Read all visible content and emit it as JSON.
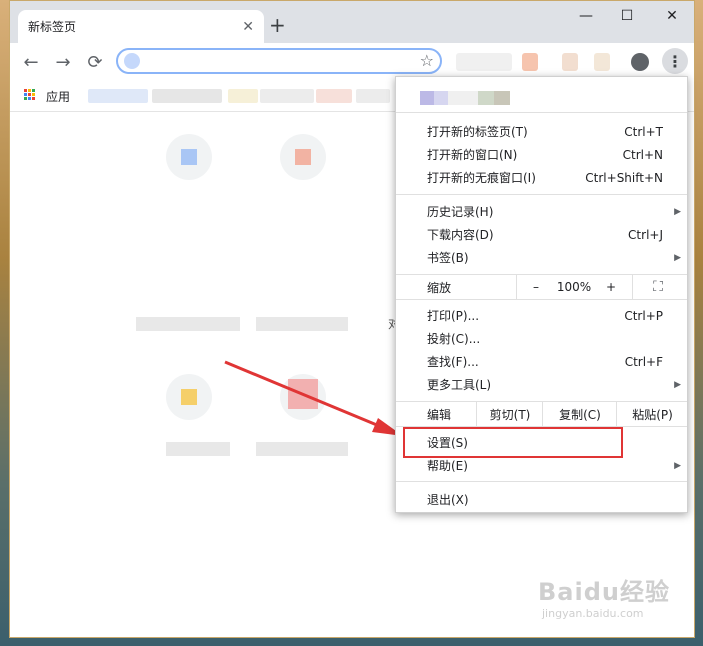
{
  "tab": {
    "title": "新标签页",
    "close": "✕"
  },
  "newtab": "+",
  "window_controls": {
    "minimize": "—",
    "maximize": "☐",
    "close": "✕"
  },
  "nav": {
    "back": "←",
    "forward": "→",
    "reload": "⟳"
  },
  "omnibox": {
    "value": "",
    "placeholder": "",
    "star": "☆"
  },
  "menu_button": "⋮",
  "bookmarks": {
    "apps_label": "应用"
  },
  "menu": {
    "items": [
      {
        "label": "打开新的标签页(T)",
        "shortcut": "Ctrl+T"
      },
      {
        "label": "打开新的窗口(N)",
        "shortcut": "Ctrl+N"
      },
      {
        "label": "打开新的无痕窗口(I)",
        "shortcut": "Ctrl+Shift+N"
      },
      {
        "label": "历史记录(H)",
        "shortcut": "▶"
      },
      {
        "label": "下载内容(D)",
        "shortcut": "Ctrl+J"
      },
      {
        "label": "书签(B)",
        "shortcut": "▶"
      },
      {
        "label": "打印(P)...",
        "shortcut": "Ctrl+P"
      },
      {
        "label": "投射(C)...",
        "shortcut": ""
      },
      {
        "label": "查找(F)...",
        "shortcut": "Ctrl+F"
      },
      {
        "label": "更多工具(L)",
        "shortcut": "▶"
      },
      {
        "label": "设置(S)",
        "shortcut": ""
      },
      {
        "label": "帮助(E)",
        "shortcut": "▶"
      },
      {
        "label": "退出(X)",
        "shortcut": ""
      }
    ],
    "zoom": {
      "label": "缩放",
      "minus": "–",
      "value": "100%",
      "plus": "+",
      "fullscreen": "⛶"
    },
    "edit": {
      "label": "编辑",
      "cut": "剪切(T)",
      "copy": "复制(C)",
      "paste": "粘贴(P)"
    }
  },
  "tiles": {
    "partial_label": "对"
  },
  "watermark": {
    "brand": "Baidu经验",
    "url": "jingyan.baidu.com"
  },
  "colors": {
    "highlight": "#e03535",
    "arrow": "#e03535",
    "accent": "#8ab4f8"
  }
}
